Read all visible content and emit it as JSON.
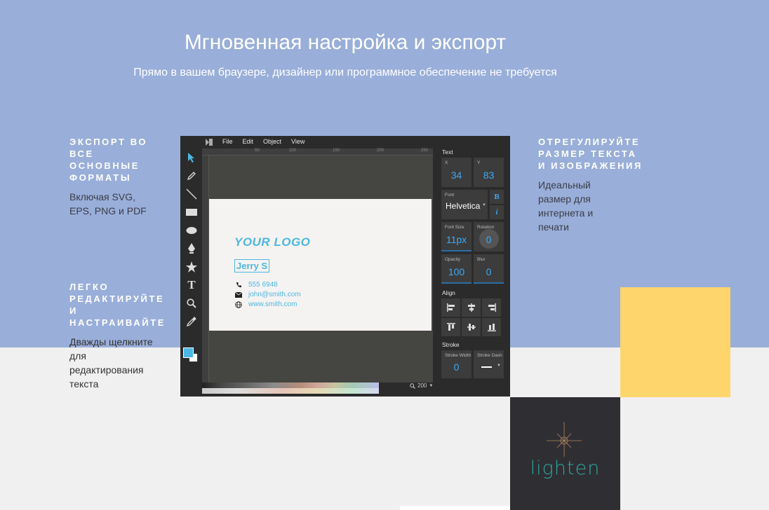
{
  "hero": {
    "title": "Мгновенная настройка и экспорт",
    "subtitle": "Прямо в вашем браузере, дизайнер или программное обеспечение не требуется"
  },
  "features": {
    "export": {
      "title": "ЭКСПОРТ ВО ВСЕ ОСНОВНЫЕ ФОРМАТЫ",
      "text": "Включая SVG, EPS, PNG и PDF"
    },
    "edit": {
      "title": "ЛЕГКО РЕДАКТИРУЙТЕ И НАСТРАИВАЙТЕ",
      "text": "Дважды щелкните для редактирования текста"
    },
    "resize": {
      "title": "ОТРЕГУЛИРУЙТЕ РАЗМЕР ТЕКСТА И ИЗОБРАЖЕНИЯ",
      "text": "Идеальный размер для интернета и печати"
    }
  },
  "editor": {
    "menu": [
      "File",
      "Edit",
      "Object",
      "View"
    ],
    "ruler_marks": [
      "50",
      "100",
      "150",
      "200",
      "250"
    ],
    "card": {
      "logo": "YOUR LOGO",
      "name": "Jerry S",
      "phone": "555 6948",
      "email": "john@smith.com",
      "website": "www.smith.com"
    },
    "zoom": "200",
    "panel": {
      "text_section": "Text",
      "x_label": "X",
      "x_value": "34",
      "y_label": "Y",
      "y_value": "83",
      "font_label": "Font",
      "font_value": "Helvetica",
      "bold": "B",
      "italic": "i",
      "font_size_label": "Font Size",
      "font_size_value": "11px",
      "rotation_label": "Rotation",
      "rotation_value": "0",
      "opacity_label": "Opacity",
      "opacity_value": "100",
      "blur_label": "Blur",
      "blur_value": "0",
      "align_section": "Align",
      "stroke_section": "Stroke",
      "stroke_width_label": "Stroke Width",
      "stroke_width_value": "0",
      "stroke_dash_label": "Stroke Dash"
    }
  },
  "brand": {
    "name": "lighten"
  },
  "colors": {
    "top_bg": "#99aed9",
    "yellow": "#fed46c",
    "dark": "#2f2e33",
    "accent": "#4cb7e4",
    "teal": "#2fa59f"
  }
}
